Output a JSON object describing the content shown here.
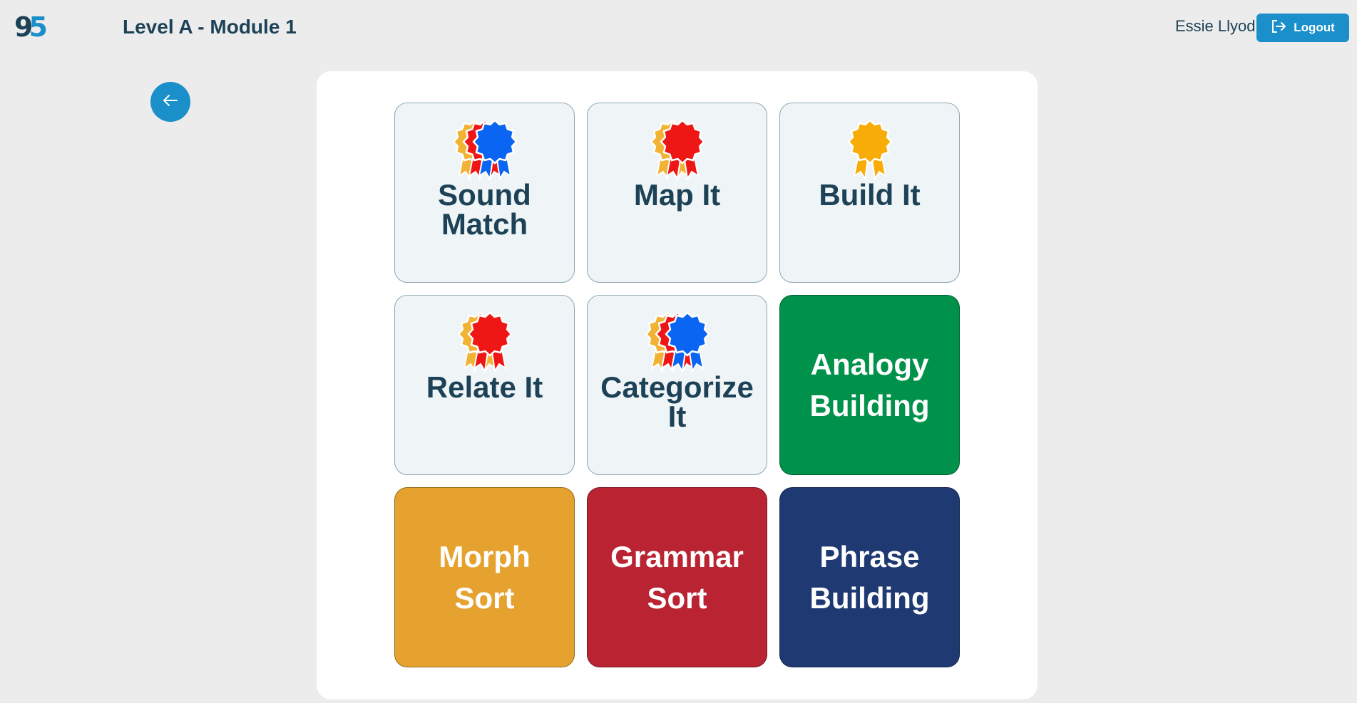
{
  "header": {
    "logo_digit_1": "9",
    "logo_digit_2": "5",
    "title": "Level A - Module 1",
    "user_name": "Essie Llyod",
    "logout_label": "Logout"
  },
  "colors": {
    "primary": "#1a8fc9",
    "text_dark": "#1d4257",
    "ribbon_orange": "#f2b233",
    "ribbon_red": "#ef1616",
    "ribbon_blue": "#0a66f2",
    "ribbon_gold": "#f8ac07"
  },
  "activities": [
    {
      "label": "Sound Match",
      "label_lines": [
        "Sound",
        "Match"
      ],
      "completed": true,
      "ribbons": [
        "orange",
        "red",
        "blue"
      ]
    },
    {
      "label": "Map It",
      "label_lines": [
        "Map It"
      ],
      "completed": true,
      "ribbons": [
        "orange",
        "red"
      ]
    },
    {
      "label": "Build It",
      "label_lines": [
        "Build It"
      ],
      "completed": true,
      "ribbons": [
        "gold"
      ]
    },
    {
      "label": "Relate It",
      "label_lines": [
        "Relate It"
      ],
      "completed": true,
      "ribbons": [
        "orange",
        "red"
      ]
    },
    {
      "label": "Categorize It",
      "label_lines": [
        "Categorize",
        "It"
      ],
      "completed": true,
      "ribbons": [
        "orange",
        "red",
        "blue"
      ]
    },
    {
      "label": "Analogy Building",
      "label_lines": [
        "Analogy",
        "Building"
      ],
      "completed": false,
      "color": "#00914a"
    },
    {
      "label": "Morph Sort",
      "label_lines": [
        "Morph",
        "Sort"
      ],
      "completed": false,
      "color": "#e6a22f"
    },
    {
      "label": "Grammar Sort",
      "label_lines": [
        "Grammar",
        "Sort"
      ],
      "completed": false,
      "color": "#b92332"
    },
    {
      "label": "Phrase Building",
      "label_lines": [
        "Phrase",
        "Building"
      ],
      "completed": false,
      "color": "#1f3a72"
    }
  ]
}
